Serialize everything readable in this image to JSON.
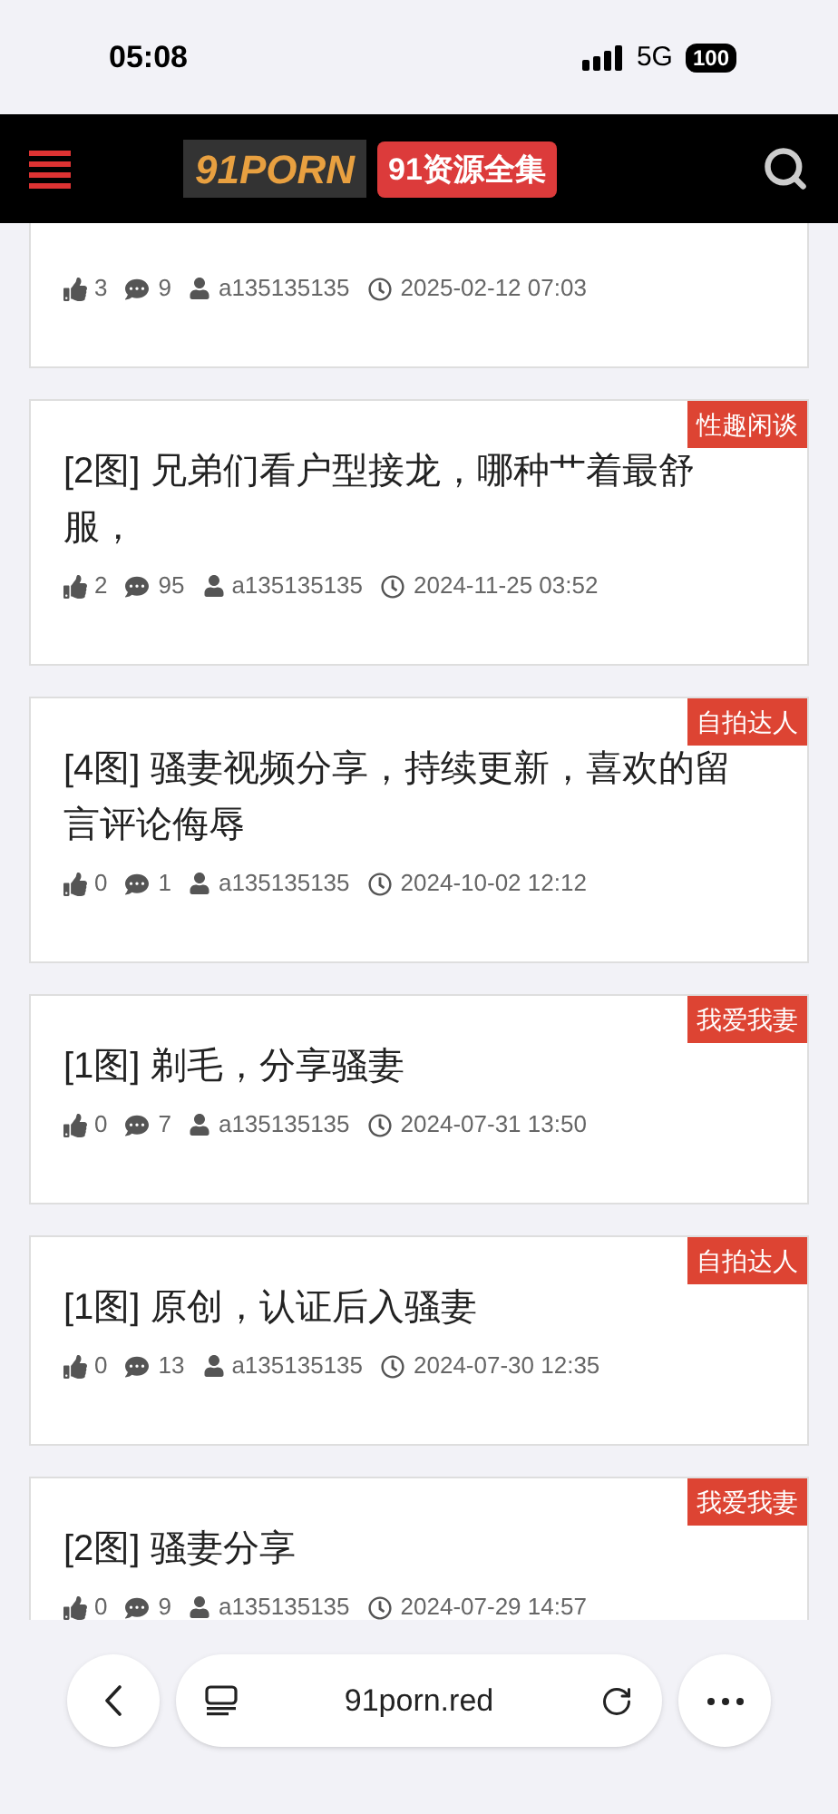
{
  "status_bar": {
    "time": "05:08",
    "network": "5G",
    "battery": "100"
  },
  "header": {
    "logo": "91PORN",
    "badge": "91资源全集"
  },
  "posts": [
    {
      "likes": "3",
      "comments": "9",
      "author": "a135135135",
      "time": "2025-02-12 07:03"
    },
    {
      "title": "[2图] 兄弟们看户型接龙，哪种艹着最舒服，",
      "tag": "性趣闲谈",
      "likes": "2",
      "comments": "95",
      "author": "a135135135",
      "time": "2024-11-25 03:52"
    },
    {
      "title": "[4图] 骚妻视频分享，持续更新，喜欢的留言评论侮辱",
      "tag": "自拍达人",
      "likes": "0",
      "comments": "1",
      "author": "a135135135",
      "time": "2024-10-02 12:12"
    },
    {
      "title": "[1图] 剃毛，分享骚妻",
      "tag": "我爱我妻",
      "likes": "0",
      "comments": "7",
      "author": "a135135135",
      "time": "2024-07-31 13:50"
    },
    {
      "title": "[1图] 原创，认证后入骚妻",
      "tag": "自拍达人",
      "likes": "0",
      "comments": "13",
      "author": "a135135135",
      "time": "2024-07-30 12:35"
    },
    {
      "title": "[2图] 骚妻分享",
      "tag": "我爱我妻",
      "likes": "0",
      "comments": "9",
      "author": "a135135135",
      "time": "2024-07-29 14:57"
    }
  ],
  "browser": {
    "url": "91porn.red"
  }
}
